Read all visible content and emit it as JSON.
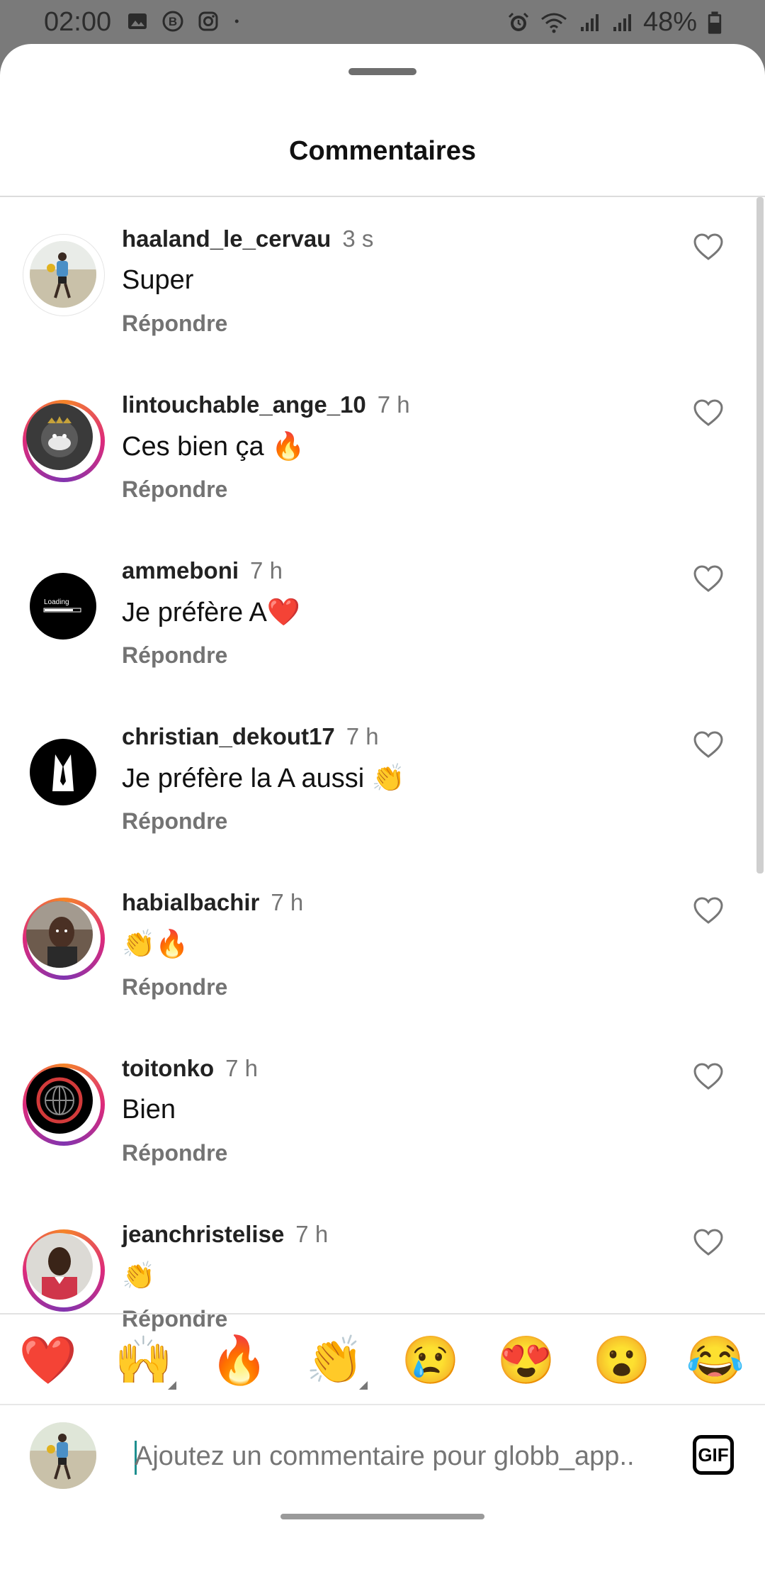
{
  "status_bar": {
    "time": "02:00",
    "battery_percent": "48%",
    "left_icons": [
      "gallery-icon",
      "b-icon",
      "instagram-icon",
      "dot-icon"
    ],
    "right_icons": [
      "alarm-icon",
      "wifi-icon",
      "signal-icon",
      "signal-icon",
      "battery-icon"
    ]
  },
  "sheet": {
    "title": "Commentaires"
  },
  "comments": [
    {
      "username": "haaland_le_cervau",
      "time": "3 s",
      "text": "Super",
      "reply_label": "Répondre",
      "avatar": "photo-player",
      "story_ring": false
    },
    {
      "username": "lintouchable_ange_10",
      "time": "7 h",
      "text": "Ces bien ça 🔥",
      "reply_label": "Répondre",
      "avatar": "photo-dark-helmet",
      "story_ring": true
    },
    {
      "username": "ammeboni",
      "time": "7 h",
      "text": "Je préfère A❤️",
      "reply_label": "Répondre",
      "avatar": "loading-graphic",
      "story_ring": false
    },
    {
      "username": "christian_dekout17",
      "time": "7 h",
      "text": "Je préfère la A aussi 👏",
      "reply_label": "Répondre",
      "avatar": "suit-graphic",
      "story_ring": false
    },
    {
      "username": "habialbachir",
      "time": "7 h",
      "text": "👏🔥",
      "reply_label": "Répondre",
      "avatar": "photo-man",
      "story_ring": true
    },
    {
      "username": "toitonko",
      "time": "7 h",
      "text": "Bien",
      "reply_label": "Répondre",
      "avatar": "globe-logo",
      "story_ring": true
    },
    {
      "username": "jeanchristelise",
      "time": "7 h",
      "text": "👏",
      "reply_label": "Répondre",
      "avatar": "photo-man-red",
      "story_ring": true
    }
  ],
  "avatar_labels": {
    "loading": "Loading"
  },
  "reactions": [
    "❤️",
    "🙌",
    "🔥",
    "👏",
    "😢",
    "😍",
    "😮",
    "😂"
  ],
  "composer": {
    "placeholder": "Ajoutez un commentaire pour globb_app..",
    "gif_label": "GIF"
  },
  "colors": {
    "status_bar_bg": "#7a7a7a",
    "story_ring_start": "#f58529",
    "story_ring_mid": "#dd2a7b",
    "secondary_text": "#737373",
    "caret": "#1e8f8f"
  }
}
